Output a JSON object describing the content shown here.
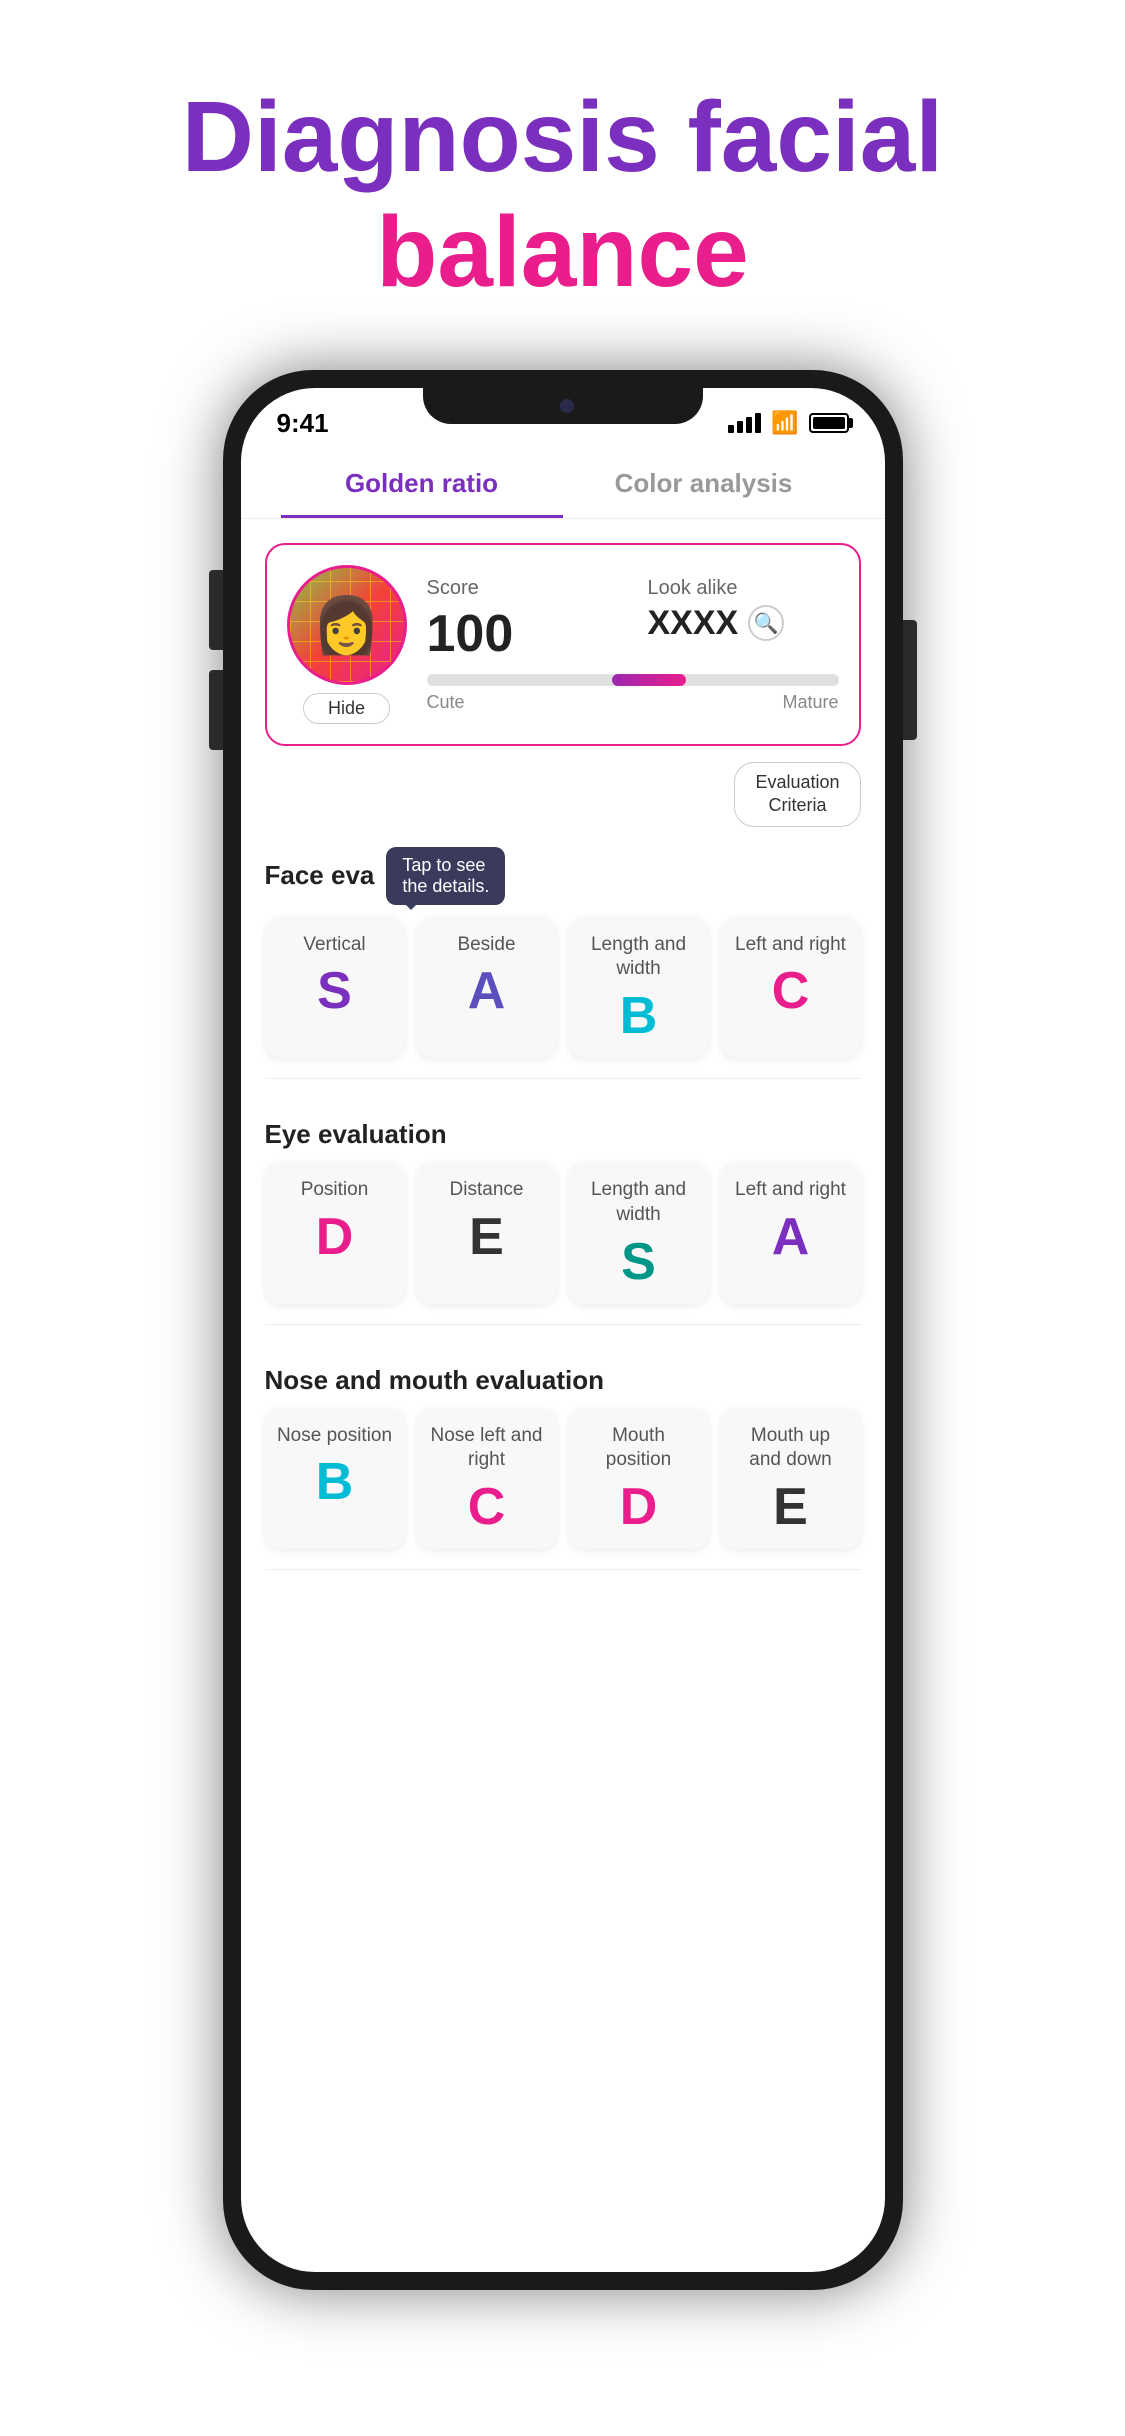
{
  "hero": {
    "title_part1": "Diagnosis facial",
    "title_part2": "balance"
  },
  "statusBar": {
    "time": "9:41",
    "signal": "signal",
    "wifi": "wifi",
    "battery": "battery"
  },
  "tabs": [
    {
      "label": "Golden ratio",
      "active": true
    },
    {
      "label": "Color analysis",
      "active": false
    }
  ],
  "scoreCard": {
    "scoreLabel": "Score",
    "scoreValue": "100",
    "lookalikeLabel": "Look alike",
    "lookalikeValue": "XXXX",
    "hideButton": "Hide",
    "cuteLabel": "Cute",
    "matureLabel": "Mature"
  },
  "evaluationCriteria": {
    "line1": "Evaluation",
    "line2": "Criteria"
  },
  "faceEvaluation": {
    "sectionLabel": "Face eva",
    "tooltip": "Tap to see\nthe details.",
    "grades": [
      {
        "label": "Vertical",
        "letter": "S",
        "colorClass": "grade-purple"
      },
      {
        "label": "Beside",
        "letter": "A",
        "colorClass": "grade-blue-purple"
      },
      {
        "label": "Length and width",
        "letter": "B",
        "colorClass": "grade-cyan"
      },
      {
        "label": "Left and right",
        "letter": "C",
        "colorClass": "grade-pink"
      }
    ]
  },
  "eyeEvaluation": {
    "sectionLabel": "Eye evaluation",
    "grades": [
      {
        "label": "Position",
        "letter": "D",
        "colorClass": "grade-pink"
      },
      {
        "label": "Distance",
        "letter": "E",
        "colorClass": "grade-dark"
      },
      {
        "label": "Length and width",
        "letter": "S",
        "colorClass": "grade-teal"
      },
      {
        "label": "Left and right",
        "letter": "A",
        "colorClass": "grade-purple"
      }
    ]
  },
  "noseAndMouthEvaluation": {
    "sectionLabel": "Nose and mouth evaluation",
    "grades": [
      {
        "label": "Nose position",
        "letter": "B",
        "colorClass": "grade-cyan"
      },
      {
        "label": "Nose left and right",
        "letter": "C",
        "colorClass": "grade-pink"
      },
      {
        "label": "Mouth position",
        "letter": "D",
        "colorClass": "grade-pink"
      },
      {
        "label": "Mouth up and down",
        "letter": "E",
        "colorClass": "grade-dark"
      }
    ]
  }
}
